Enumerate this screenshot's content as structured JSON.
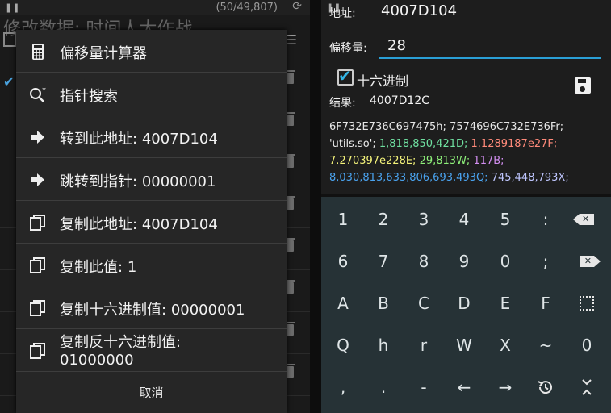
{
  "background_app": {
    "counter": "(50/49,807)",
    "title": "修改数据: 时间人大作战"
  },
  "menu": {
    "items": [
      {
        "icon": "calculator-icon",
        "label": "偏移量计算器",
        "value": ""
      },
      {
        "icon": "pointer-search-icon",
        "label": "指针搜索",
        "value": ""
      },
      {
        "icon": "arrow-right-icon",
        "label": "转到此地址:",
        "value": "4007D104"
      },
      {
        "icon": "arrow-right-icon",
        "label": "跳转到指针:",
        "value": "00000001"
      },
      {
        "icon": "copy-icon",
        "label": "复制此地址:",
        "value": "4007D104"
      },
      {
        "icon": "copy-icon",
        "label": "复制此值:",
        "value": "1"
      },
      {
        "icon": "copy-icon",
        "label": "复制十六进制值:",
        "value": "00000001"
      },
      {
        "icon": "copy-icon",
        "label": "复制反十六进制值:",
        "value": "01000000"
      }
    ],
    "cancel_label": "取消"
  },
  "offset_calc": {
    "address_label": "地址:",
    "address_value": "4007D104",
    "offset_label": "偏移量:",
    "offset_value": "28",
    "hex_label": "十六进制",
    "hex_checked": true,
    "result_label": "结果:",
    "result_value": "4007D12C",
    "conversions": [
      {
        "text": "6F732E736C697475h;",
        "color": "#e8e8e8"
      },
      {
        "text": "7574696C732E736Fr;",
        "color": "#e8e8e8"
      },
      {
        "text": "'utils.so';",
        "color": "#e8e8e8"
      },
      {
        "text": "1,818,850,421D;",
        "color": "#6fdfa0"
      },
      {
        "text": "1.1289187e27F;",
        "color": "#ff8a7a"
      },
      {
        "text": "7.270397e228E;",
        "color": "#f3f27a"
      },
      {
        "text": "29,813W;",
        "color": "#8ef07a"
      },
      {
        "text": "117B;",
        "color": "#d28ef0"
      },
      {
        "text": "8,030,813,633,806,693,493Q;",
        "color": "#4aa3ef"
      },
      {
        "text": "745,448,793X;",
        "color": "#bfc6ff"
      }
    ]
  },
  "keyboard": {
    "rows": [
      [
        "1",
        "2",
        "3",
        "4",
        "5",
        ":",
        "backspace"
      ],
      [
        "6",
        "7",
        "8",
        "9",
        "0",
        ";",
        "backspace"
      ],
      [
        "A",
        "B",
        "C",
        "D",
        "E",
        "F",
        "select-all"
      ],
      [
        "Q",
        "h",
        "r",
        "W",
        "X",
        "~",
        "0"
      ],
      [
        ",",
        ".",
        "-",
        "←",
        "→",
        "history",
        "collapse"
      ]
    ]
  }
}
